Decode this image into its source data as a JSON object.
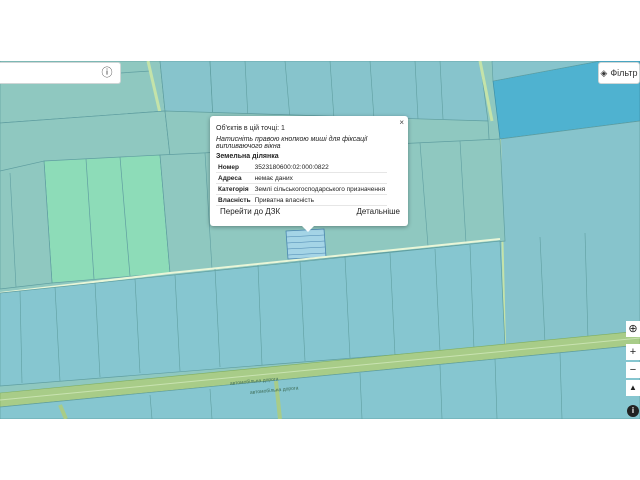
{
  "search": {
    "info_icon": "info-icon"
  },
  "filter_button": {
    "label": "Фільтр",
    "icon": "layers-icon"
  },
  "popup": {
    "count": "Об'єктів в цій точці: 1",
    "hint": "Натисніть правою кнопкою миші для фіксації випливаючого вікна",
    "section_title": "Земельна ділянка",
    "rows": [
      {
        "key": "Номер",
        "value": "3523180600:02:000:0822"
      },
      {
        "key": "Адреса",
        "value": "немає даних"
      },
      {
        "key": "Категорія",
        "value": "Землі сільськогосподарського призначення"
      },
      {
        "key": "Власність",
        "value": "Приватна власність"
      }
    ],
    "go_dzk": "Перейти до ДЗК",
    "details": "Детальніше",
    "close": "×"
  },
  "map_labels": {
    "road_1": "автомобільна дорога",
    "road_2": "автомобільна дорога"
  },
  "controls": {
    "locate": "⊕",
    "zoom_in": "+",
    "zoom_out": "−",
    "compass": "▲",
    "info": "i"
  },
  "colors": {
    "parcel_fill": "#8fc8c0",
    "parcel_alt": "#86c6d0",
    "highlight_green": "#8ddcb8",
    "water_blue": "#4fb2d0",
    "road": "#a8cc88",
    "parcel_border": "#5f9ea0"
  }
}
